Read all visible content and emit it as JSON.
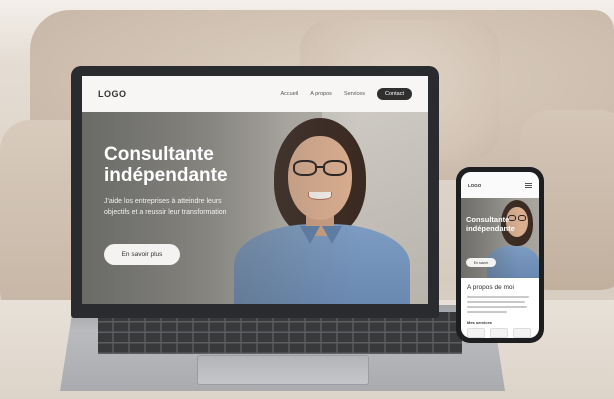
{
  "laptop_site": {
    "logo": "LOGO",
    "nav": {
      "about": "A propos",
      "services": "Services",
      "accueil": "Accueil",
      "contact": "Contact"
    },
    "hero_title_line1": "Consultante",
    "hero_title_line2": "indépendante",
    "hero_subtitle": "J'aide los entreprises à atteindre leurs objectifs et a reussir leur transformation",
    "hero_button": "En savoir plus"
  },
  "phone_site": {
    "logo": "LOGO",
    "hero_title_line1": "Consultante",
    "hero_title_line2": "indépendante",
    "hero_button": "En savoir",
    "about_heading": "A propos de moi",
    "services_heading": "Mes services"
  },
  "colors": {
    "nav_background": "#f7f6f4",
    "contact_button": "#2f2f2f",
    "hero_button_bg": "#f4f3f1",
    "shirt": "#7d9cc2"
  }
}
